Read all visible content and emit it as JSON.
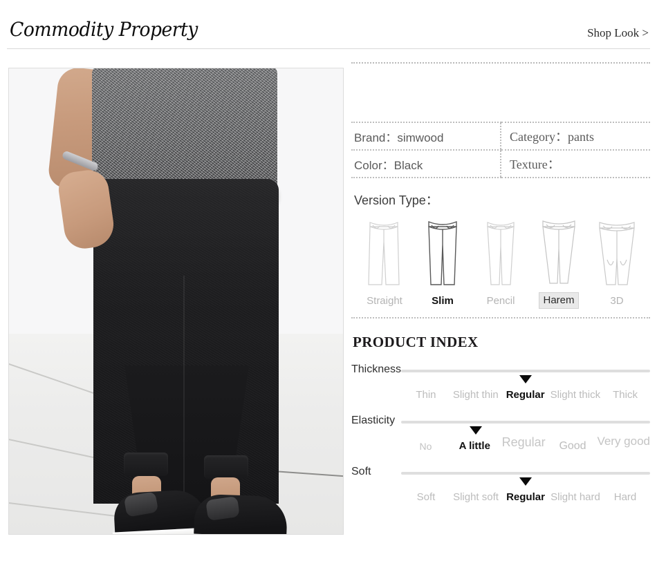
{
  "header": {
    "title": "Commodity Property",
    "shop_look": "Shop Look  >"
  },
  "product_image": {
    "alt": "Man wearing black harem jogger pants with grey marled t-shirt and black slip-on sneakers"
  },
  "spec_table": {
    "rows": [
      [
        {
          "label": "Brand：",
          "value": "simwood"
        },
        {
          "label": "Category：",
          "value": "pants"
        }
      ],
      [
        {
          "label": "Color：",
          "value": "Black"
        },
        {
          "label": "Texture：",
          "value": ""
        }
      ]
    ],
    "cells": {
      "brand": "Brand：simwood",
      "category": "Category：pants",
      "color": "Color：Black",
      "texture": "Texture："
    }
  },
  "version_type": {
    "title": "Version Type：",
    "options": [
      {
        "label": "Straight",
        "state": "normal"
      },
      {
        "label": "Slim",
        "state": "active"
      },
      {
        "label": "Pencil",
        "state": "normal"
      },
      {
        "label": "Harem",
        "state": "boxed"
      },
      {
        "label": "3D",
        "state": "normal"
      }
    ]
  },
  "product_index": {
    "title": "PRODUCT INDEX",
    "rows": [
      {
        "label": "Thickness",
        "options": [
          "Thin",
          "Slight thin",
          "Regular",
          "Slight thick",
          "Thick"
        ],
        "selected": "Regular",
        "marker_percent": 50
      },
      {
        "label": "Elasticity",
        "options": [
          "No",
          "A little",
          "Regular",
          "Good",
          "Very good"
        ],
        "selected": "A little",
        "marker_percent": 30
      },
      {
        "label": "Soft",
        "options": [
          "Soft",
          "Slight soft",
          "Regular",
          "Slight hard",
          "Hard"
        ],
        "selected": "Regular",
        "marker_percent": 50
      }
    ]
  },
  "colors": {
    "accent_dark": "#101010",
    "muted_text": "#bcbcbc",
    "dotted_border": "#bdbdbd",
    "track": "#dedede",
    "highlight_box": "#e9e9e9"
  }
}
